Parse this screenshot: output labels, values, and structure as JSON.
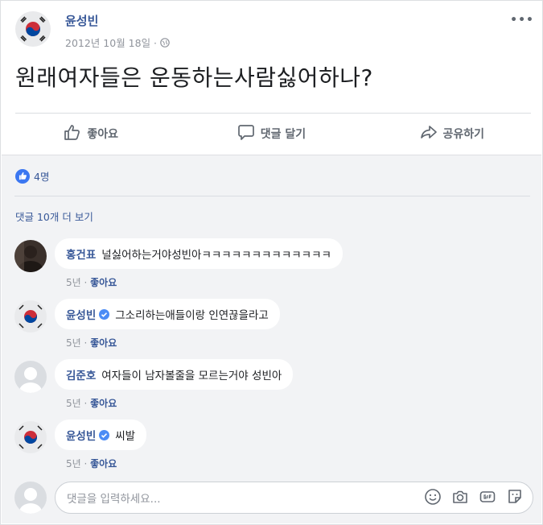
{
  "post": {
    "author": "윤성빈",
    "date": "2012년 10월 18일 ·",
    "text": "원래여자들은 운동하는사람싫어하나?",
    "more": "•••"
  },
  "actions": {
    "like": "좋아요",
    "comment": "댓글 달기",
    "share": "공유하기"
  },
  "reactions": {
    "count": "4명"
  },
  "view_more": "댓글 10개 더 보기",
  "comments": [
    {
      "name": "홍건표",
      "text": "널싫어하는거야성빈아ㅋㅋㅋㅋㅋㅋㅋㅋㅋㅋㅋㅋㅋ",
      "time": "5년",
      "sep": " · ",
      "like": "좋아요"
    },
    {
      "name": "윤성빈",
      "text": "그소리하는애들이랑 인연끊을라고",
      "time": "5년",
      "sep": " · ",
      "like": "좋아요"
    },
    {
      "name": "김준호",
      "text": "여자들이 남자볼줄을 모르는거야 성빈아",
      "time": "5년",
      "sep": " · ",
      "like": "좋아요"
    },
    {
      "name": "윤성빈",
      "text": "씨발",
      "time": "5년",
      "sep": " · ",
      "like": "좋아요"
    }
  ],
  "compose": {
    "placeholder": "댓글을 입력하세요..."
  },
  "colors": {
    "link": "#385898",
    "flag_red": "#cd2e3a",
    "flag_blue": "#0047a0",
    "like_blue": "#3b77f1"
  }
}
